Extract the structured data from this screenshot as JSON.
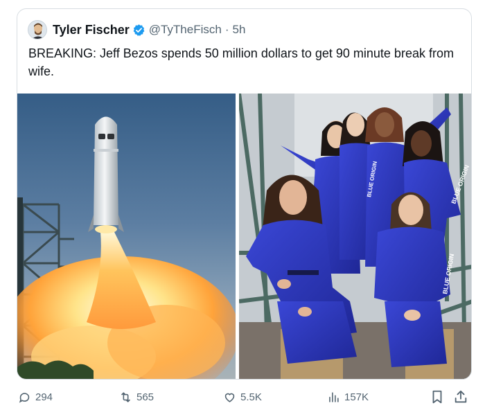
{
  "tweet": {
    "author_name": "Tyler Fischer",
    "handle": "@TyTheFisch",
    "separator": "·",
    "time": "5h",
    "text": "BREAKING: Jeff Bezos spends 50 million dollars to get 90 minute break from wife."
  },
  "media": {
    "left_image": "rocket-launch-photo",
    "right_image": "crew-group-photo",
    "suit_lettering": "BLUE ORIGIN"
  },
  "metrics": {
    "replies": "294",
    "reposts": "565",
    "likes": "5.5K",
    "views": "157K"
  },
  "colors": {
    "verified_blue": "#1d9bf0",
    "muted_text": "#536471",
    "suit_blue": "#2a34b8"
  }
}
